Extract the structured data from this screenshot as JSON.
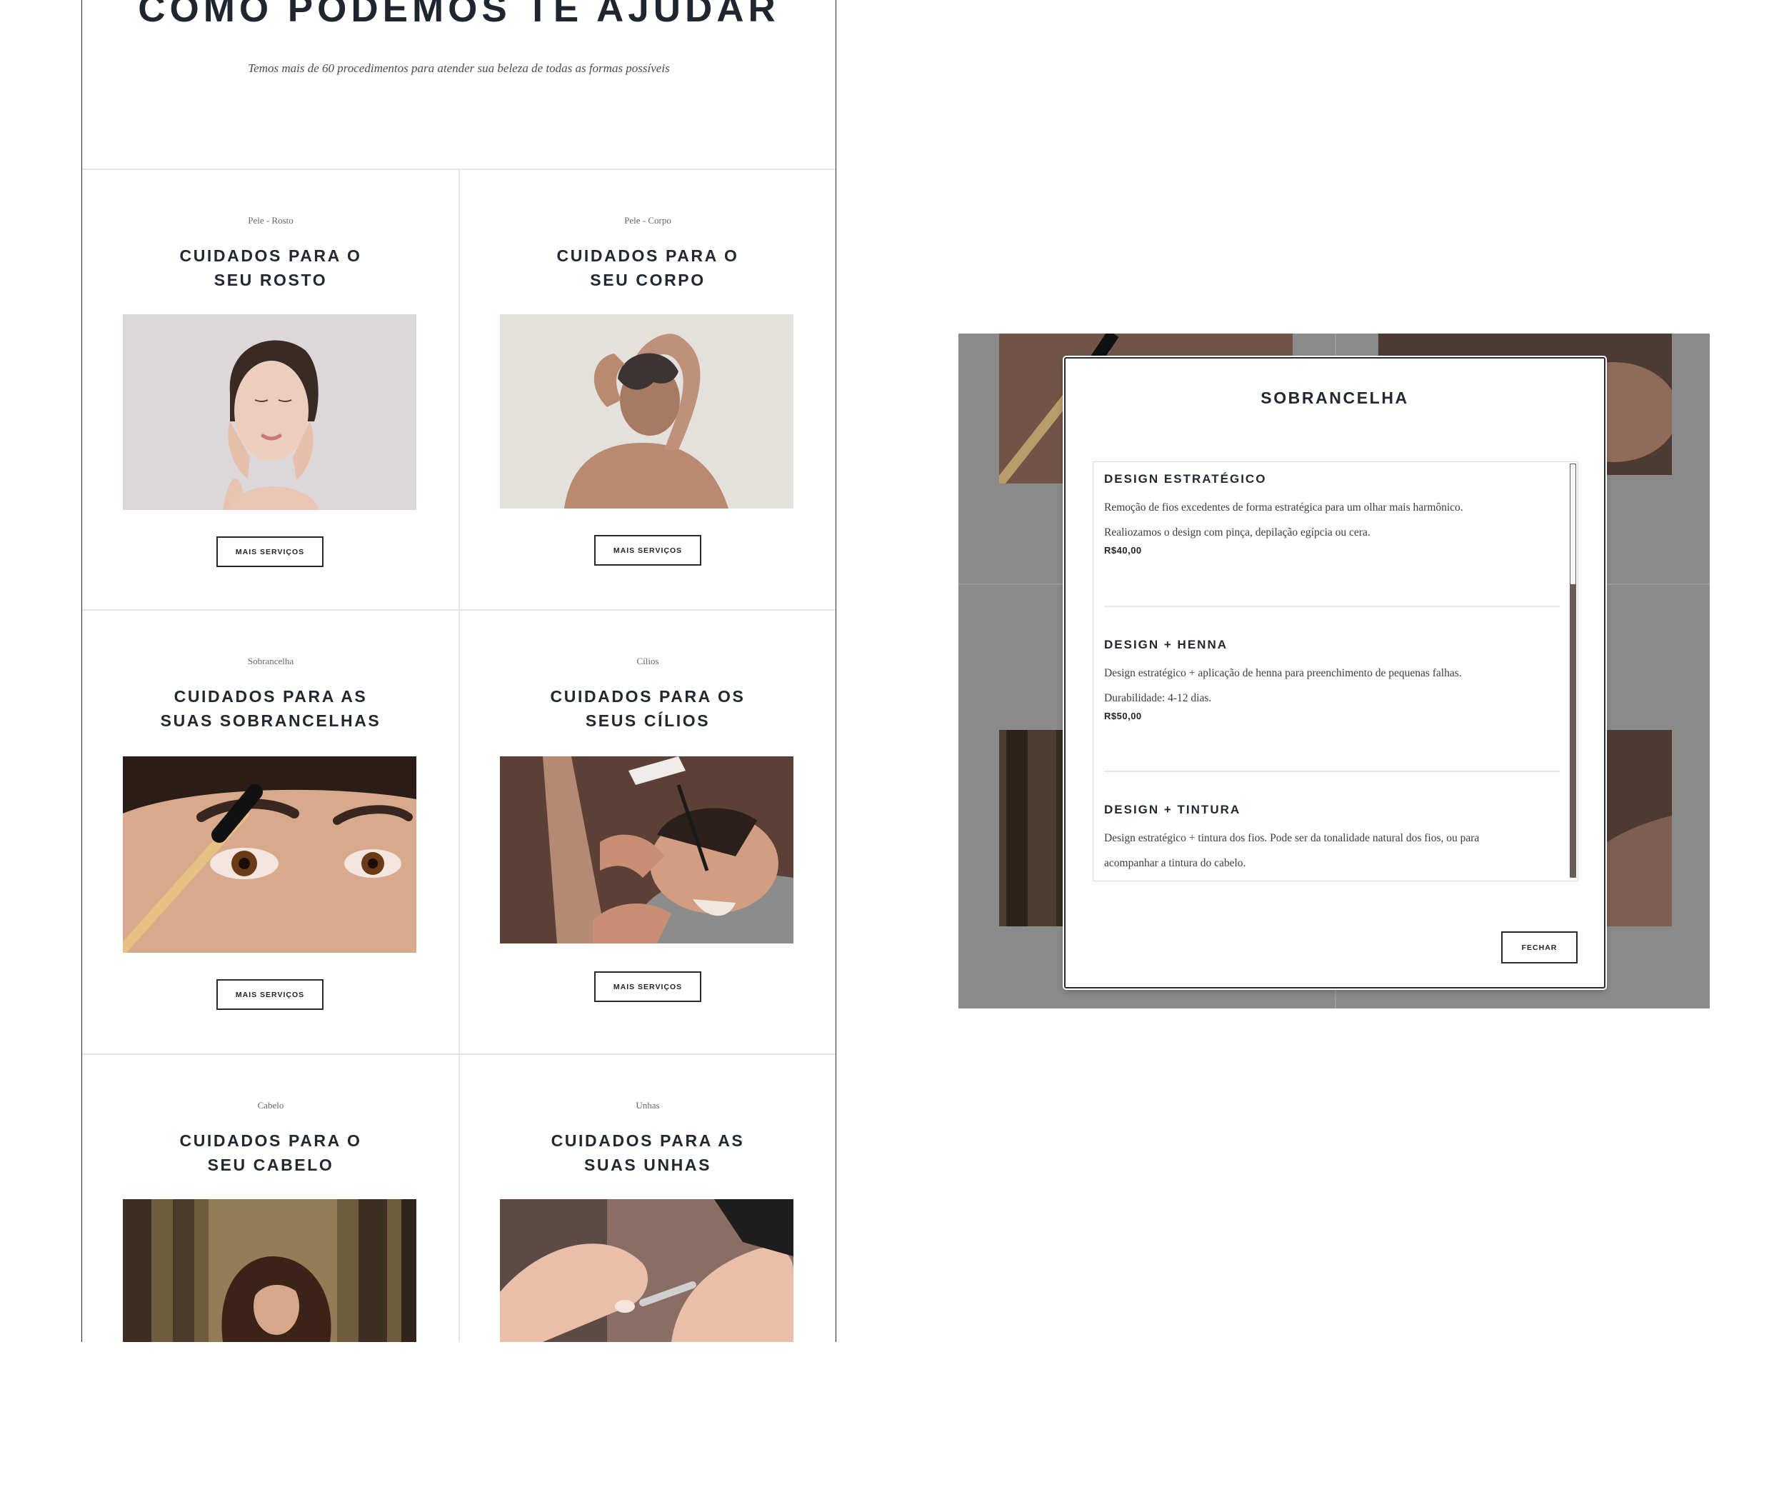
{
  "hero": {
    "title": "COMO PODEMOS TE AJUDAR",
    "subtitle": "Temos mais de 60 procedimentos para atender sua beleza de todas as formas possíveis"
  },
  "cards": [
    {
      "category": "Pele - Rosto",
      "title": "CUIDADOS PARA O\nSEU ROSTO",
      "button": "MAIS SERVIÇOS",
      "image": "face-skincare-photo"
    },
    {
      "category": "Pele - Corpo",
      "title": "CUIDADOS PARA O\nSEU CORPO",
      "button": "MAIS SERVIÇOS",
      "image": "body-care-photo"
    },
    {
      "category": "Sobrancelha",
      "title": "CUIDADOS PARA AS\nSUAS SOBRANCELHAS",
      "button": "MAIS SERVIÇOS",
      "image": "eyebrow-brush-photo"
    },
    {
      "category": "Cílios",
      "title": "CUIDADOS PARA OS\nSEUS CÍLIOS",
      "button": "MAIS SERVIÇOS",
      "image": "eyelash-extension-photo"
    },
    {
      "category": "Cabelo",
      "title": "CUIDADOS PARA O\nSEU CABELO",
      "button": "",
      "image": "hair-forest-photo"
    },
    {
      "category": "Unhas",
      "title": "CUIDADOS PARA AS\nSUAS UNHAS",
      "button": "",
      "image": "nail-care-photo"
    }
  ],
  "modal": {
    "title": "SOBRANCELHA",
    "services": [
      {
        "name": "DESIGN ESTRATÉGICO",
        "lines": [
          "Remoção de fios excedentes de forma estratégica para um olhar mais harmônico.",
          "Realiozamos o design com pinça, depilação egípcia ou cera."
        ],
        "price": "R$40,00"
      },
      {
        "name": "DESIGN + HENNA",
        "lines": [
          "Design estratégico + aplicação de henna para preenchimento de pequenas falhas.",
          "Durabilidade: 4-12 dias."
        ],
        "price": "R$50,00"
      },
      {
        "name": "DESIGN + TINTURA",
        "lines": [
          "Design estratégico + tintura dos fios. Pode ser da tonalidade natural dos fios, ou para",
          "acompanhar a tintura do cabelo."
        ],
        "price": ""
      }
    ],
    "close_label": "FECHAR"
  },
  "colors": {
    "heading": "#222831",
    "overlay": "#8a8a8a",
    "scrollbar": "#6a5d58"
  }
}
